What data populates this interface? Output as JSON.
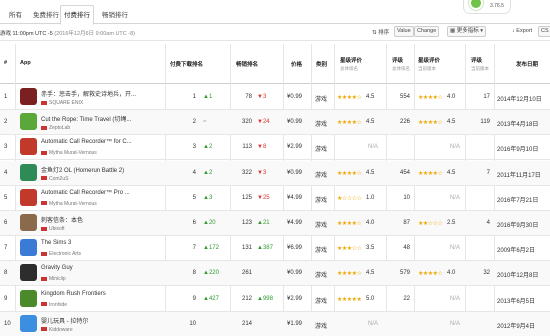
{
  "tabs": [
    "所有",
    "免费排行",
    "付费排行",
    "畅销排行"
  ],
  "active_tab": 2,
  "badge": {
    "text": "3.76.5"
  },
  "filter": {
    "prefix": "游戏 11:00pm UTC -5",
    "date": "(2016年12月6日 9:00am UTC -8)"
  },
  "toolbar": {
    "sort_label": "排序",
    "value_btn": "Value",
    "change_btn": "Change",
    "more_btn": "更多指标",
    "export_btn": "Export",
    "cs_btn": "CS"
  },
  "columns": {
    "hash": "#",
    "app": "App",
    "paid_rank": "付费下载排名",
    "gross_rank": "畅销排名",
    "price": "价格",
    "category": "类别",
    "rating_all": "星级评价",
    "rating_all_sub": "总体排名",
    "reviews_all": "评级",
    "reviews_all_sub": "总体排名",
    "rating_cur": "星级评价",
    "rating_cur_sub": "当前版本",
    "reviews_cur": "评级",
    "reviews_cur_sub": "当前版本",
    "release": "发布日期"
  },
  "rows": [
    {
      "n": "1",
      "name": "赤手：惩击手，解救史诗地兵，开...",
      "dev": "SQUARE ENIX",
      "color": "#7b2020",
      "paid": "1",
      "pch": "▲1",
      "pdir": "up",
      "gross": "78",
      "gch": "▼3",
      "gdir": "down",
      "price": "¥0.99",
      "cat": "游戏",
      "stars_all": "★★★★☆",
      "r_all": "4.5",
      "rev_all": "554",
      "stars_cur": "★★★★☆",
      "r_cur": "4.0",
      "rev_cur": "17",
      "date": "2014年12月10日"
    },
    {
      "n": "2",
      "name": "Cut the Rope: Time Travel (切绳...",
      "dev": "ZeptoLab",
      "color": "#5aa83a",
      "paid": "2",
      "pch": "=",
      "pdir": "na",
      "gross": "320",
      "gch": "▼24",
      "gdir": "down",
      "price": "¥0.99",
      "cat": "游戏",
      "stars_all": "★★★★☆",
      "r_all": "4.5",
      "rev_all": "226",
      "stars_cur": "★★★★☆",
      "r_cur": "4.5",
      "rev_cur": "119",
      "date": "2013年4月18日"
    },
    {
      "n": "3",
      "name": "Automatic Call Recorder™ for C...",
      "dev": "Mytha Murat-Vernous",
      "color": "#c0392b",
      "paid": "3",
      "pch": "▲2",
      "pdir": "up",
      "gross": "113",
      "gch": "▼8",
      "gdir": "down",
      "price": "¥2.99",
      "cat": "游戏",
      "stars_all": "",
      "r_all": "N/A",
      "rev_all": "",
      "stars_cur": "",
      "r_cur": "N/A",
      "rev_cur": "",
      "date": "2016年9月10日"
    },
    {
      "n": "4",
      "name": "金鱼灯2 OL (Homerun Battle 2)",
      "dev": "Com2uS",
      "color": "#2e8b57",
      "paid": "4",
      "pch": "▲2",
      "pdir": "up",
      "gross": "322",
      "gch": "▼3",
      "gdir": "down",
      "price": "¥0.99",
      "cat": "游戏",
      "stars_all": "★★★★☆",
      "r_all": "4.5",
      "rev_all": "454",
      "stars_cur": "★★★★☆",
      "r_cur": "4.5",
      "rev_cur": "7",
      "date": "2011年11月17日"
    },
    {
      "n": "5",
      "name": "Automatic Call Recorder™ Pro ...",
      "dev": "Mytha Murat-Vernous",
      "color": "#c0392b",
      "paid": "5",
      "pch": "▲3",
      "pdir": "up",
      "gross": "125",
      "gch": "▼25",
      "gdir": "down",
      "price": "¥4.99",
      "cat": "游戏",
      "stars_all": "★☆☆☆☆",
      "r_all": "1.0",
      "rev_all": "10",
      "stars_cur": "",
      "r_cur": "N/A",
      "rev_cur": "",
      "date": "2016年7月21日"
    },
    {
      "n": "6",
      "name": "刺客信条：本色",
      "dev": "Ubisoft",
      "color": "#8a6a4a",
      "paid": "6",
      "pch": "▲20",
      "pdir": "up",
      "gross": "123",
      "gch": "▲21",
      "gdir": "up",
      "price": "¥4.99",
      "cat": "游戏",
      "stars_all": "★★★★☆",
      "r_all": "4.0",
      "rev_all": "87",
      "stars_cur": "★★☆☆☆",
      "r_cur": "2.5",
      "rev_cur": "4",
      "date": "2016年9月30日"
    },
    {
      "n": "7",
      "name": "The Sims 3",
      "dev": "Electronic Arts",
      "color": "#3a7bd5",
      "paid": "7",
      "pch": "▲172",
      "pdir": "up",
      "gross": "131",
      "gch": "▲387",
      "gdir": "up",
      "price": "¥6.99",
      "cat": "游戏",
      "stars_all": "★★★☆☆",
      "r_all": "3.5",
      "rev_all": "48",
      "stars_cur": "",
      "r_cur": "N/A",
      "rev_cur": "",
      "date": "2009年6月2日"
    },
    {
      "n": "8",
      "name": "Gravity Guy",
      "dev": "Miniclip",
      "color": "#2d2d2d",
      "paid": "8",
      "pch": "▲220",
      "pdir": "up",
      "gross": "261",
      "gch": "",
      "gdir": "na",
      "price": "¥0.99",
      "cat": "游戏",
      "stars_all": "★★★★☆",
      "r_all": "4.5",
      "rev_all": "579",
      "stars_cur": "★★★★☆",
      "r_cur": "4.0",
      "rev_cur": "32",
      "date": "2010年12月8日"
    },
    {
      "n": "9",
      "name": "Kingdom Rush Frontiers",
      "dev": "Ironhide",
      "color": "#4a8a2a",
      "paid": "9",
      "pch": "▲427",
      "pdir": "up",
      "gross": "212",
      "gch": "▲998",
      "gdir": "up",
      "price": "¥2.99",
      "cat": "游戏",
      "stars_all": "★★★★★",
      "r_all": "5.0",
      "rev_all": "22",
      "stars_cur": "",
      "r_cur": "N/A",
      "rev_cur": "",
      "date": "2013年6月5日"
    },
    {
      "n": "10",
      "name": "婴儿玩具 - 拉特尔",
      "dev": "Kiddoware",
      "color": "#3c8ee0",
      "paid": "10",
      "pch": "",
      "pdir": "na",
      "gross": "214",
      "gch": "",
      "gdir": "na",
      "price": "¥1.99",
      "cat": "游戏",
      "stars_all": "",
      "r_all": "N/A",
      "rev_all": "",
      "stars_cur": "",
      "r_cur": "N/A",
      "rev_cur": "",
      "date": "2012年9月4日"
    }
  ]
}
